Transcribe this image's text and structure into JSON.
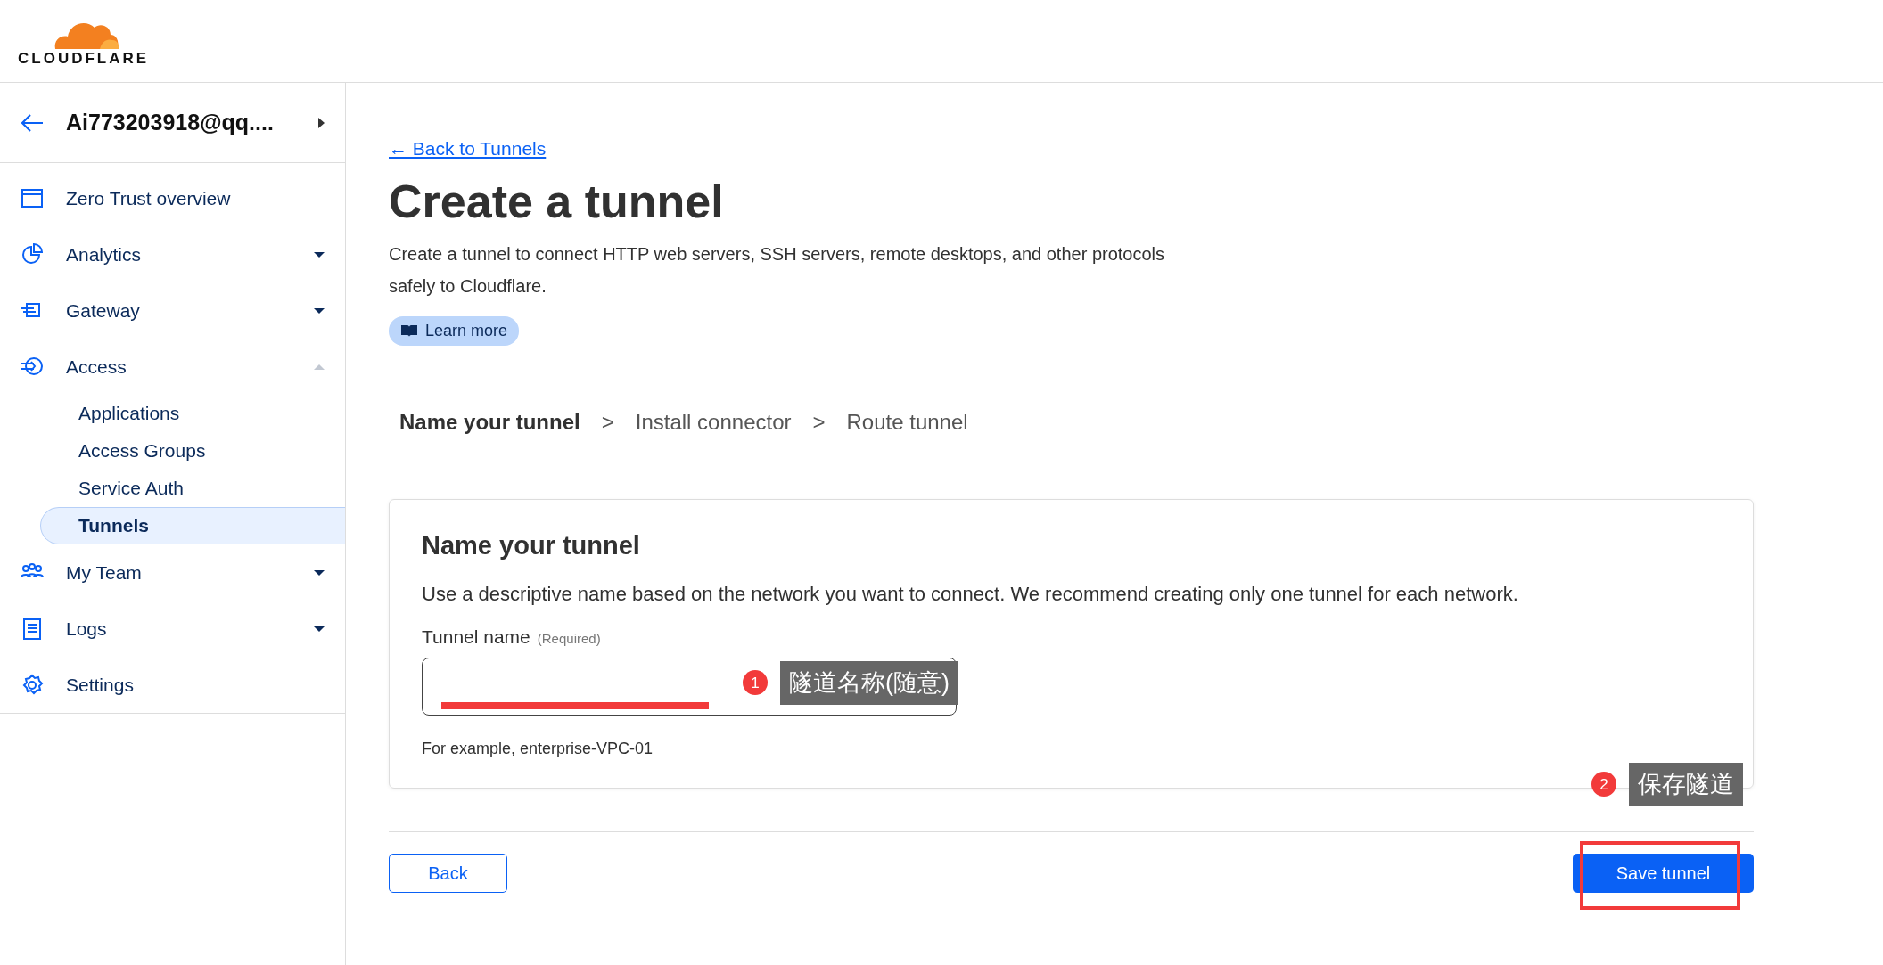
{
  "logo": {
    "text": "CLOUDFLARE"
  },
  "account": {
    "name": "Ai773203918@qq...."
  },
  "sidebar": {
    "items": [
      {
        "label": "Zero Trust overview",
        "selected": false
      },
      {
        "label": "Analytics",
        "selected": false,
        "expanded": false
      },
      {
        "label": "Gateway",
        "selected": false,
        "expanded": false
      },
      {
        "label": "Access",
        "selected": false,
        "expanded": true,
        "children": [
          {
            "label": "Applications",
            "selected": false
          },
          {
            "label": "Access Groups",
            "selected": false
          },
          {
            "label": "Service Auth",
            "selected": false
          },
          {
            "label": "Tunnels",
            "selected": true
          }
        ]
      },
      {
        "label": "My Team",
        "selected": false,
        "expanded": false
      },
      {
        "label": "Logs",
        "selected": false,
        "expanded": false
      },
      {
        "label": "Settings",
        "selected": false
      }
    ]
  },
  "back_link": "← Back to Tunnels",
  "title": "Create a tunnel",
  "description": "Create a tunnel to connect HTTP web servers, SSH servers, remote desktops, and other protocols safely to Cloudflare.",
  "learn_more": "Learn more",
  "steps": [
    {
      "label": "Name your tunnel",
      "selected": true
    },
    {
      "label": "Install connector",
      "selected": false
    },
    {
      "label": "Route tunnel",
      "selected": false
    }
  ],
  "step_separator": ">",
  "card": {
    "title": "Name your tunnel",
    "description": "Use a descriptive name based on the network you want to connect. We recommend creating only one tunnel for each network.",
    "field_label": "Tunnel name",
    "field_note": "(Required)",
    "hint": "For example, enterprise-VPC-01"
  },
  "buttons": {
    "back": "Back",
    "save": "Save tunnel"
  },
  "annotations": [
    {
      "number": "1",
      "text": "隧道名称(随意)"
    },
    {
      "number": "2",
      "text": "保存隧道"
    }
  ]
}
